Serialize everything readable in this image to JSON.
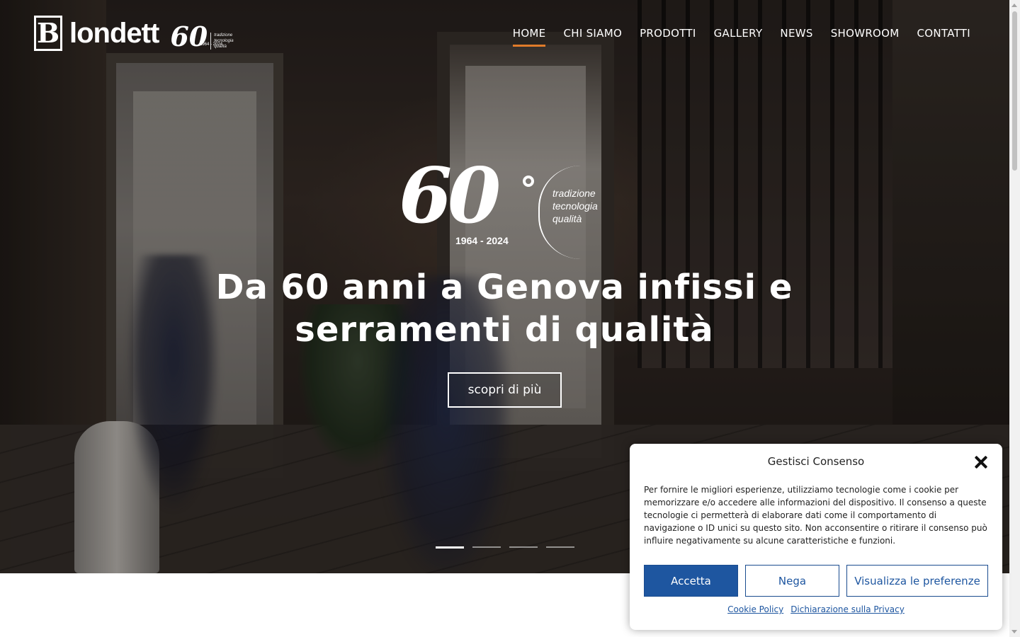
{
  "brand": {
    "initial": "B",
    "word": "londett",
    "anniversary_number": "60",
    "anniversary_years": "1964 - 2024",
    "anniversary_words": [
      "tradizione",
      "tecnologia",
      "qualità"
    ]
  },
  "nav": {
    "items": [
      {
        "label": "HOME",
        "active": true
      },
      {
        "label": "CHI SIAMO",
        "active": false
      },
      {
        "label": "PRODOTTI",
        "active": false
      },
      {
        "label": "GALLERY",
        "active": false
      },
      {
        "label": "NEWS",
        "active": false
      },
      {
        "label": "SHOWROOM",
        "active": false
      },
      {
        "label": "CONTATTI",
        "active": false
      }
    ],
    "active_color": "#e07b2a"
  },
  "hero": {
    "emblem_number": "60",
    "emblem_years": "1964 - 2024",
    "emblem_words": [
      "tradizione",
      "tecnologia",
      "qualità"
    ],
    "title_line1": "Da 60 anni a Genova infissi e",
    "title_line2": "serramenti di qualità",
    "cta_label": "scopri di più",
    "slides": 4,
    "active_slide": 1
  },
  "consent": {
    "title": "Gestisci Consenso",
    "body": "Per fornire le migliori esperienze, utilizziamo tecnologie come i cookie per memorizzare e/o accedere alle informazioni del dispositivo. Il consenso a queste tecnologie ci permetterà di elaborare dati come il comportamento di navigazione o ID unici su questo sito. Non acconsentire o ritirare il consenso può influire negativamente su alcune caratteristiche e funzioni.",
    "accept_label": "Accetta",
    "deny_label": "Nega",
    "prefs_label": "Visualizza le preferenze",
    "cookie_policy_label": "Cookie Policy",
    "privacy_label": "Dichiarazione sulla Privacy",
    "accent_color": "#1e56a0"
  }
}
